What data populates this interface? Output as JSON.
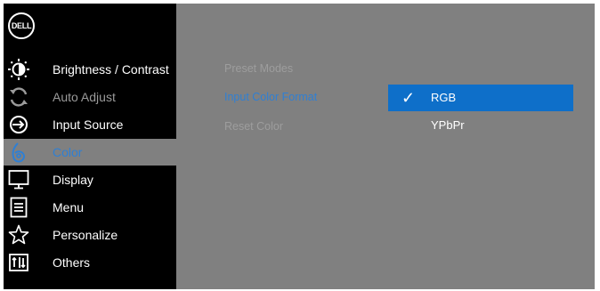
{
  "logo": {
    "text": "DELL"
  },
  "menu": [
    {
      "label": "Brightness / Contrast",
      "icon": "brightness-icon",
      "state": "normal"
    },
    {
      "label": "Auto Adjust",
      "icon": "auto-adjust-icon",
      "state": "disabled"
    },
    {
      "label": "Input Source",
      "icon": "input-source-icon",
      "state": "normal"
    },
    {
      "label": "Color",
      "icon": "color-icon",
      "state": "active"
    },
    {
      "label": "Display",
      "icon": "display-icon",
      "state": "normal"
    },
    {
      "label": "Menu",
      "icon": "menu-icon",
      "state": "normal"
    },
    {
      "label": "Personalize",
      "icon": "star-icon",
      "state": "normal"
    },
    {
      "label": "Others",
      "icon": "others-icon",
      "state": "normal"
    }
  ],
  "submenu": [
    {
      "label": "Preset Modes",
      "state": "disabled"
    },
    {
      "label": "Input Color Format",
      "state": "active"
    },
    {
      "label": "Reset Color",
      "state": "disabled"
    }
  ],
  "options": [
    {
      "label": "RGB",
      "selected": true,
      "check": "✓"
    },
    {
      "label": "YPbPr",
      "selected": false,
      "check": ""
    }
  ],
  "colors": {
    "sidebar_bg": "#000000",
    "panel_bg": "#808080",
    "accent_blue": "#2f7fd3",
    "selected_bg": "#0e6fc9"
  }
}
